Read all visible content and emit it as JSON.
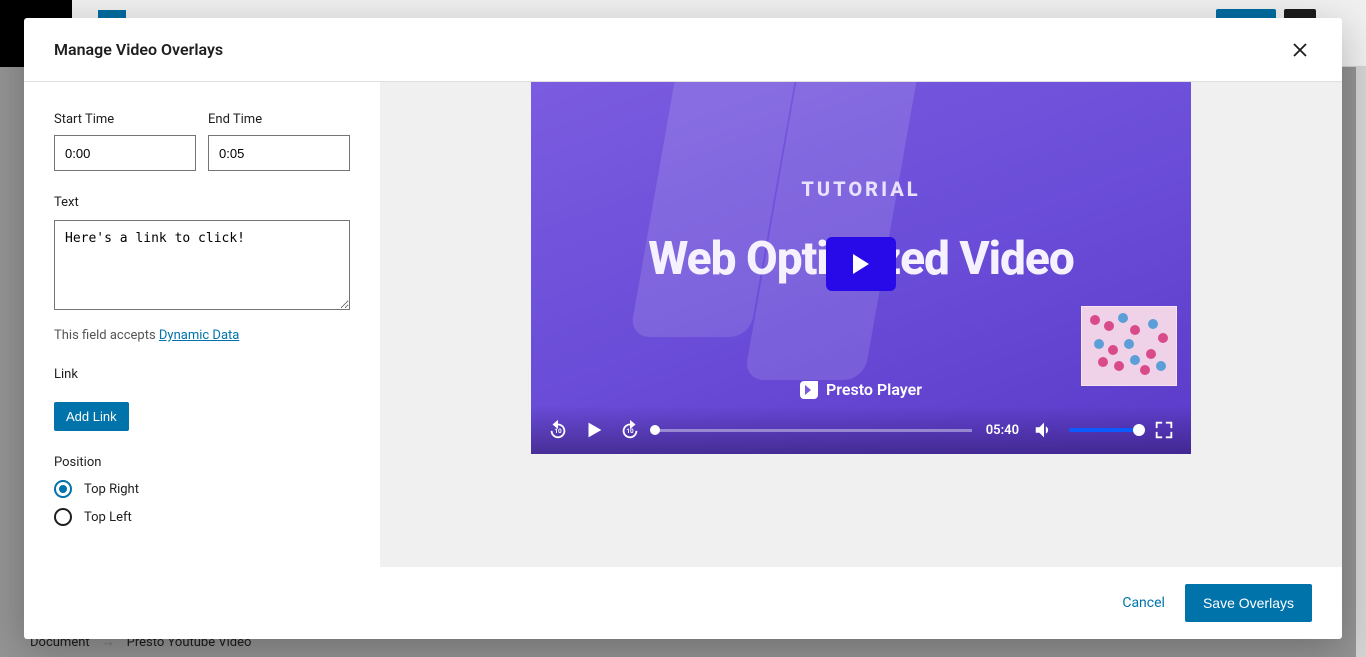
{
  "modal": {
    "title": "Manage Video Overlays",
    "start_time_label": "Start Time",
    "start_time_value": "0:00",
    "end_time_label": "End Time",
    "end_time_value": "0:05",
    "text_label": "Text",
    "text_value": "Here's a link to click!",
    "hint_prefix": "This field accepts ",
    "hint_link": "Dynamic Data",
    "link_label": "Link",
    "add_link_button": "Add Link",
    "position_label": "Position",
    "position_options": {
      "top_right": "Top Right",
      "top_left": "Top Left"
    },
    "position_selected": "top_right",
    "cancel_label": "Cancel",
    "save_label": "Save Overlays"
  },
  "video": {
    "tag": "TUTORIAL",
    "title": "Web Optimized Video",
    "brand": "Presto Player",
    "time": "05:40"
  },
  "breadcrumb": {
    "root": "Document",
    "current": "Presto Youtube Video"
  }
}
